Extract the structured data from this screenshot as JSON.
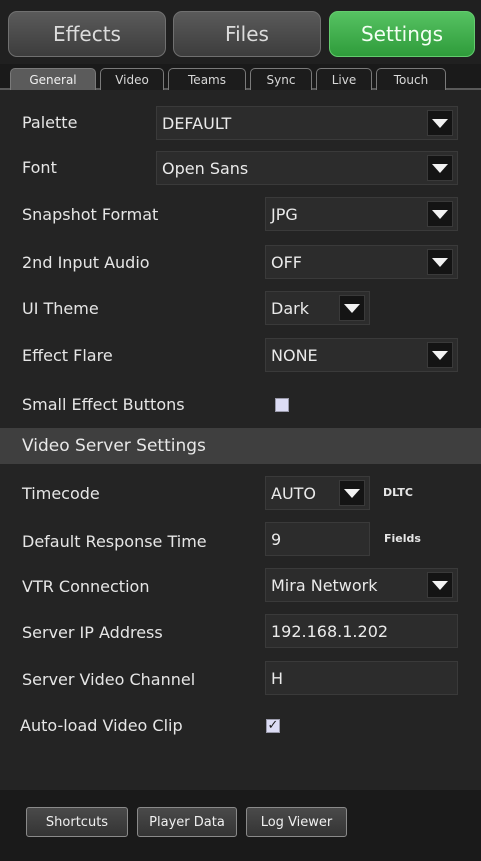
{
  "main_tabs": [
    {
      "label": "Effects",
      "active": false
    },
    {
      "label": "Files",
      "active": false
    },
    {
      "label": "Settings",
      "active": true
    }
  ],
  "sub_tabs": [
    {
      "label": "General",
      "active": true
    },
    {
      "label": "Video",
      "active": false
    },
    {
      "label": "Teams",
      "active": false
    },
    {
      "label": "Sync",
      "active": false
    },
    {
      "label": "Live",
      "active": false
    },
    {
      "label": "Touch",
      "active": false
    }
  ],
  "general": {
    "palette": {
      "label": "Palette",
      "value": "DEFAULT"
    },
    "font": {
      "label": "Font",
      "value": "Open Sans"
    },
    "snapshot_format": {
      "label": "Snapshot Format",
      "value": "JPG"
    },
    "second_input_audio": {
      "label": "2nd Input Audio",
      "value": "OFF"
    },
    "ui_theme": {
      "label": "UI Theme",
      "value": "Dark"
    },
    "effect_flare": {
      "label": "Effect Flare",
      "value": "NONE"
    },
    "small_effect_buttons": {
      "label": "Small Effect Buttons",
      "checked": false
    }
  },
  "video_server": {
    "header": "Video Server Settings",
    "timecode": {
      "label": "Timecode",
      "value": "AUTO",
      "unit": "DLTC"
    },
    "default_response_time": {
      "label": "Default Response Time",
      "value": "9",
      "unit": "Fields"
    },
    "vtr_connection": {
      "label": "VTR Connection",
      "value": "Mira Network"
    },
    "server_ip": {
      "label": "Server IP Address",
      "value": "192.168.1.202"
    },
    "server_video_channel": {
      "label": "Server Video Channel",
      "value": "H"
    },
    "auto_load_video_clip": {
      "label": "Auto-load Video Clip",
      "checked": true
    }
  },
  "footer": {
    "shortcuts": "Shortcuts",
    "player_data": "Player Data",
    "log_viewer": "Log Viewer"
  },
  "colors": {
    "accent_green": "#3fae4b",
    "background": "#242424",
    "section_header": "#3f3f3f"
  },
  "icons": {
    "dropdown": "triangle-down-icon",
    "check": "checkmark-icon"
  }
}
